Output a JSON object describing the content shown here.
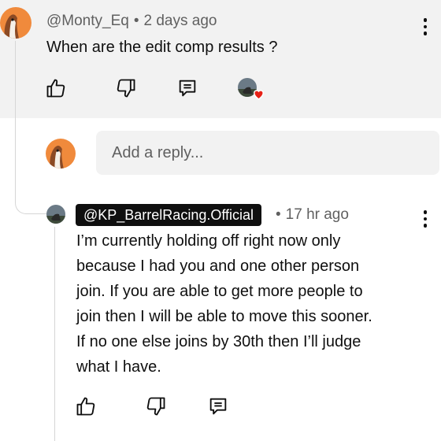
{
  "top_comment": {
    "author": "@Monty_Eq",
    "separator": "•",
    "time": "2 days ago",
    "text": "When are the edit comp results ?",
    "heart_color": "#e62117"
  },
  "reply_box": {
    "placeholder": "Add a reply..."
  },
  "reply": {
    "author": "@KP_BarrelRacing.Official",
    "separator": "•",
    "time": "17 hr ago",
    "lines": [
      "I’m currently holding off right now only",
      "because I had you and one other person",
      "join. If you are able to get more people to",
      "join then I will be able to move this sooner.",
      "If no one else joins by 30th then I’ll judge",
      "what I have."
    ]
  },
  "icons": {
    "like": "thumbs-up-icon",
    "dislike": "thumbs-down-icon",
    "reply": "reply-comment-icon",
    "more": "more-vertical-icon",
    "creator_heart": "creator-heart-icon"
  },
  "colors": {
    "top_comment_bg": "#f2f2f2",
    "badge_bg": "#0f0f0f",
    "meta_text": "#606060"
  }
}
